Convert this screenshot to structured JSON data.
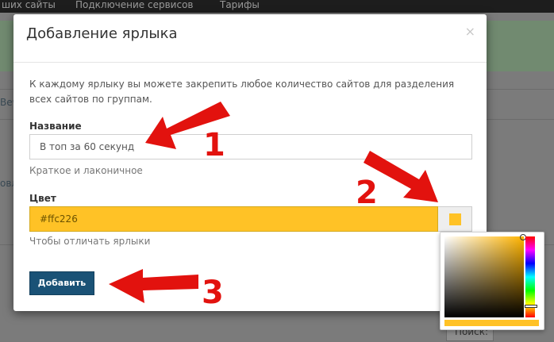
{
  "nav": {
    "items": [
      "ших сайты",
      "Подключение сервисов",
      "Тарифы"
    ]
  },
  "background": {
    "fragment_1": "Веч",
    "fragment_2": "овл",
    "search_label": "Поиск:"
  },
  "modal": {
    "title": "Добавление ярлыка",
    "close_glyph": "×",
    "intro": "К каждому ярлыку вы можете закрепить любое количество сайтов для разделения всех сайтов по группам.",
    "name_label": "Название",
    "name_value": "В топ за 60 секунд",
    "name_hint": "Краткое и лаконичное",
    "color_label": "Цвет",
    "color_value": "#ffc226",
    "color_hint": "Чтобы отличать ярлыки",
    "submit_label": "Добавить"
  },
  "colors": {
    "selected": "#ffc226",
    "accent_button": "#1a5276",
    "arrow_red": "#e2120e"
  },
  "annotations": {
    "step1": "1",
    "step2": "2",
    "step3": "3"
  },
  "icons": {
    "close": "close-icon",
    "swatch": "color-swatch-icon"
  }
}
